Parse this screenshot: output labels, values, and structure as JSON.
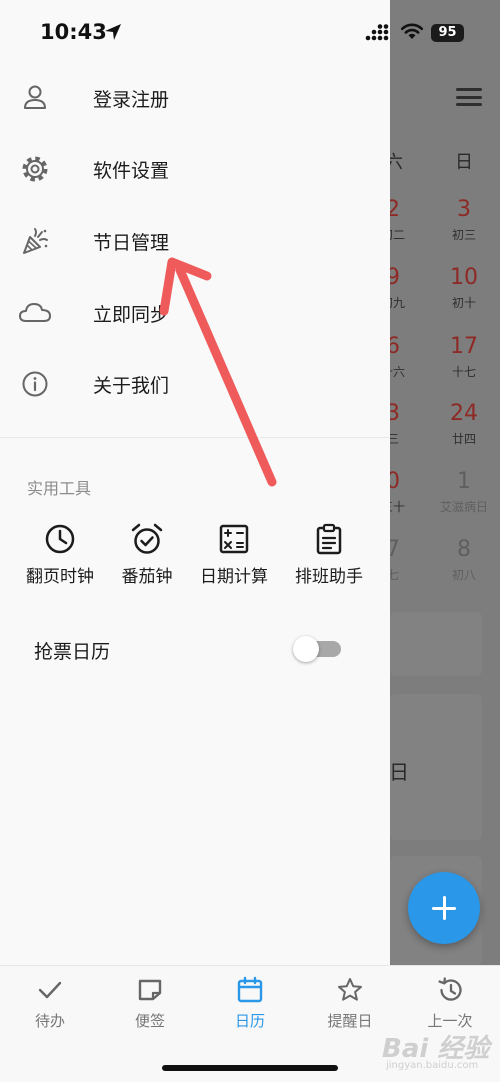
{
  "status_bar": {
    "time": "10:43",
    "battery": "95"
  },
  "drawer": {
    "menu": [
      {
        "label": "登录注册",
        "icon": "person-icon"
      },
      {
        "label": "软件设置",
        "icon": "gear-icon"
      },
      {
        "label": "节日管理",
        "icon": "party-popper-icon"
      },
      {
        "label": "立即同步",
        "icon": "cloud-icon"
      },
      {
        "label": "关于我们",
        "icon": "info-icon"
      }
    ],
    "tools_title": "实用工具",
    "tools": [
      {
        "label": "翻页时钟",
        "icon": "clock-icon"
      },
      {
        "label": "番茄钟",
        "icon": "alarm-clock-icon"
      },
      {
        "label": "日期计算",
        "icon": "calculator-icon"
      },
      {
        "label": "排班助手",
        "icon": "clipboard-icon"
      }
    ],
    "toggle_row": {
      "label": "抢票日历",
      "on": false
    }
  },
  "calendar_bg": {
    "weekday_headers": [
      "六",
      "日"
    ],
    "rows": [
      {
        "sat_num": "2",
        "sat_sub": "初二",
        "sun_num": "3",
        "sun_sub": "初三"
      },
      {
        "sat_num": "9",
        "sat_sub": "初九",
        "sun_num": "10",
        "sun_sub": "初十"
      },
      {
        "sat_num": "6",
        "sat_sub": "十六",
        "sun_num": "17",
        "sun_sub": "十七"
      },
      {
        "sat_num": "3",
        "sat_sub": "三",
        "sun_num": "24",
        "sun_sub": "廿四"
      },
      {
        "sat_num": "0",
        "sat_sub": "三十",
        "sun_num": "1",
        "sun_sub": "艾滋病日"
      },
      {
        "sat_num": "7",
        "sat_sub": "七",
        "sun_num": "8",
        "sun_sub": "初八"
      }
    ],
    "partial_text": "日"
  },
  "bottom_nav": {
    "tabs": [
      {
        "label": "待办",
        "icon": "check-icon"
      },
      {
        "label": "便签",
        "icon": "note-icon"
      },
      {
        "label": "日历",
        "icon": "calendar-icon",
        "active": true
      },
      {
        "label": "提醒日",
        "icon": "star-icon"
      },
      {
        "label": "上一次",
        "icon": "history-icon"
      }
    ]
  },
  "watermark": {
    "logo": "Bai 经验",
    "url": "jingyan.baidu.com"
  },
  "colors": {
    "accent": "#2a97e8",
    "arrow": "#ef5b5b",
    "holiday_red": "#8e2a25"
  }
}
